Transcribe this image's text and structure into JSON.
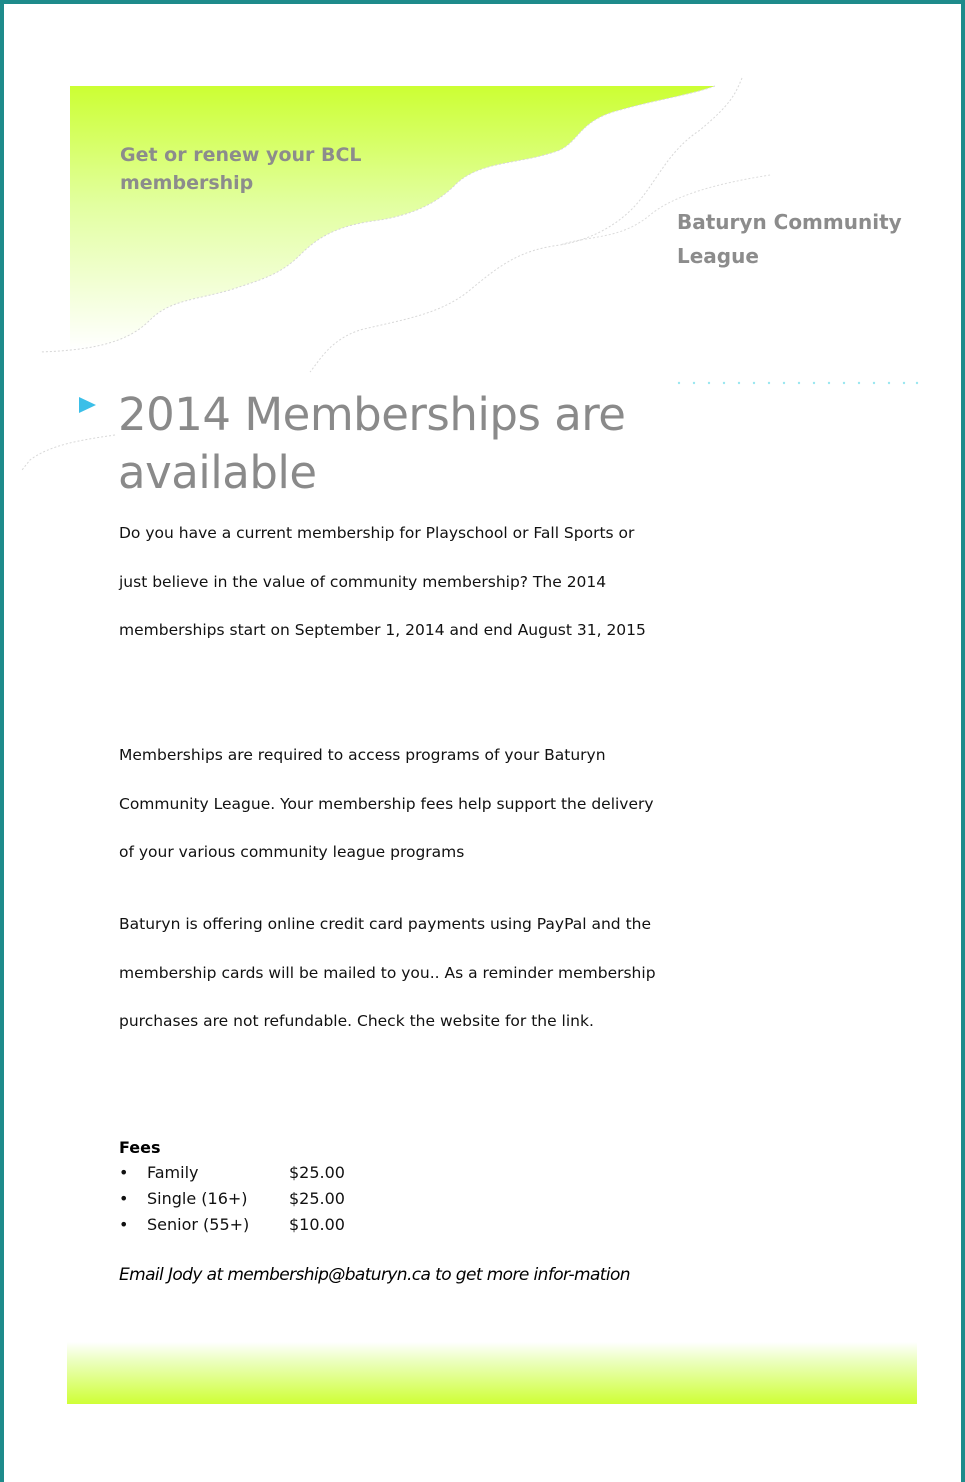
{
  "banner": {
    "tagline": "Get or renew your BCL membership",
    "organization": "Baturyn Community League"
  },
  "article": {
    "headline": "2014 Memberships are available",
    "paragraphs": [
      "Do you have a current membership for Playschool or Fall Sports or just believe in the value of community membership?  The 2014 memberships start on September 1, 2014 and end August 31, 2015",
      "Memberships are required to access programs of your Baturyn Community League.  Your membership fees help support the delivery of your various community league programs",
      "Baturyn is offering online credit card payments using PayPal and the membership cards will be mailed to you..  As a reminder membership purchases are not refundable.  Check the website for the link."
    ]
  },
  "fees": {
    "heading": "Fees",
    "items": [
      {
        "name": "Family",
        "price": "$25.00"
      },
      {
        "name": "Single (16+)",
        "price": "$25.00"
      },
      {
        "name": "Senior (55+)",
        "price": "$10.00"
      }
    ]
  },
  "contact": {
    "note": "Email Jody at membership@baturyn.ca to  get  more infor-mation"
  },
  "colors": {
    "accent_green": "#ccff33",
    "frame_teal": "#1e8b8b",
    "bullet_blue": "#3bbfe8",
    "dots_cyan": "#9be7f0",
    "heading_gray": "#8a8a8a"
  }
}
